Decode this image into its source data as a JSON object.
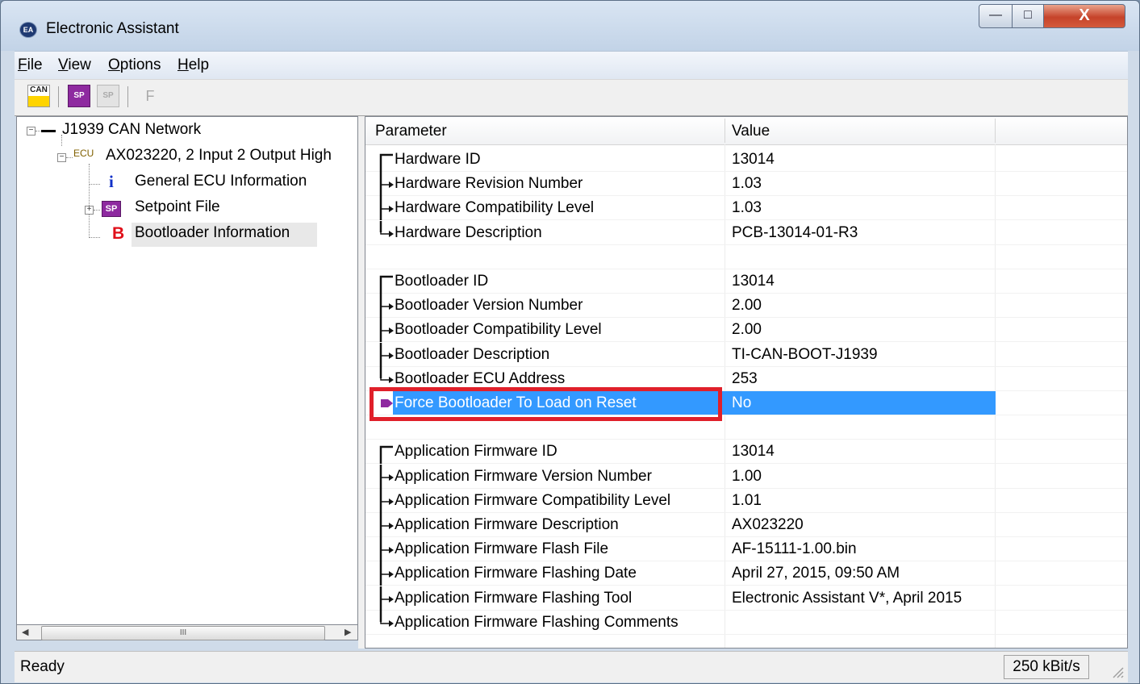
{
  "window": {
    "title": "Electronic Assistant",
    "app_icon": "EA"
  },
  "caption_buttons": {
    "minimize": "—",
    "maximize": "□",
    "close": "X"
  },
  "menu": [
    {
      "label": "File",
      "accel": "F",
      "rest": "ile"
    },
    {
      "label": "View",
      "accel": "V",
      "rest": "iew"
    },
    {
      "label": "Options",
      "accel": "O",
      "rest": "ptions"
    },
    {
      "label": "Help",
      "accel": "H",
      "rest": "elp"
    }
  ],
  "toolbar": {
    "buttons": [
      {
        "name": "can-connect-icon",
        "text": "CAN"
      },
      {
        "name": "open-setpoint-icon",
        "text": "SP"
      },
      {
        "name": "save-setpoint-icon",
        "text": "SP"
      },
      {
        "name": "flash-icon",
        "text": "F"
      }
    ]
  },
  "tree": {
    "root": "J1939 CAN Network",
    "ecu_prefix": "ECU",
    "ecu": "AX023220, 2 Input 2 Output High",
    "items": [
      {
        "label": "General ECU Information",
        "icon_text": "i"
      },
      {
        "label": "Setpoint File",
        "icon_text": "SP"
      },
      {
        "label": "Bootloader Information",
        "icon_text": "B"
      }
    ],
    "scroll_thumb": "III"
  },
  "table": {
    "columns": [
      "Parameter",
      "Value"
    ],
    "rows": [
      {
        "param": "Hardware ID",
        "value": "13014",
        "conn": "top"
      },
      {
        "param": "Hardware Revision Number",
        "value": "1.03",
        "conn": "mid"
      },
      {
        "param": "Hardware Compatibility Level",
        "value": "1.03",
        "conn": "mid"
      },
      {
        "param": "Hardware Description",
        "value": "PCB-13014-01-R3",
        "conn": "end"
      },
      {
        "param": "",
        "value": "",
        "conn": "none"
      },
      {
        "param": "Bootloader ID",
        "value": "13014",
        "conn": "top"
      },
      {
        "param": "Bootloader Version Number",
        "value": "2.00",
        "conn": "mid"
      },
      {
        "param": "Bootloader Compatibility Level",
        "value": "2.00",
        "conn": "mid"
      },
      {
        "param": "Bootloader Description",
        "value": "TI-CAN-BOOT-J1939",
        "conn": "mid"
      },
      {
        "param": "Bootloader ECU Address",
        "value": "253",
        "conn": "end"
      },
      {
        "param": "Force Bootloader To Load on Reset",
        "value": "No",
        "conn": "edit"
      },
      {
        "param": "",
        "value": "",
        "conn": "none"
      },
      {
        "param": "Application Firmware ID",
        "value": "13014",
        "conn": "top"
      },
      {
        "param": "Application Firmware Version Number",
        "value": "1.00",
        "conn": "mid"
      },
      {
        "param": "Application Firmware Compatibility Level",
        "value": "1.01",
        "conn": "mid"
      },
      {
        "param": "Application Firmware Description",
        "value": "AX023220",
        "conn": "mid"
      },
      {
        "param": "Application Firmware Flash File",
        "value": "AF-15111-1.00.bin",
        "conn": "mid"
      },
      {
        "param": "Application Firmware Flashing Date",
        "value": "April 27, 2015, 09:50 AM",
        "conn": "mid"
      },
      {
        "param": "Application Firmware Flashing Tool",
        "value": "Electronic Assistant V*, April 2015",
        "conn": "mid"
      },
      {
        "param": "Application Firmware Flashing Comments",
        "value": "",
        "conn": "end"
      }
    ],
    "selected_index": 10
  },
  "status": {
    "text": "Ready",
    "baud": "250 kBit/s"
  },
  "colors": {
    "selection": "#3399ff",
    "highlight_box": "#e0202a"
  }
}
